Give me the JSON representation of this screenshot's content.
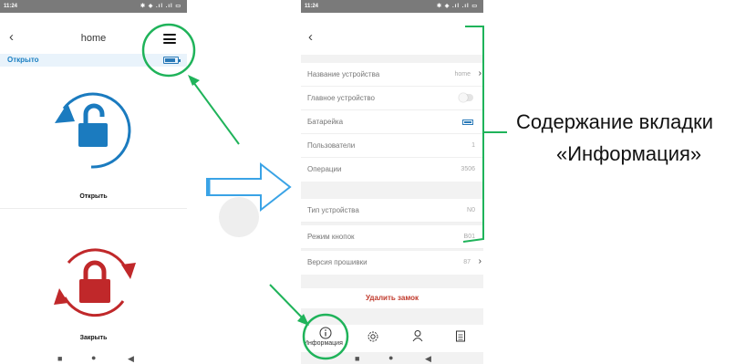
{
  "left_screen": {
    "status_time": "11:24",
    "status_icons": "✱ ◈ .ıl .ıl ▭",
    "header_title": "home",
    "status_text": "Открыто",
    "open_label": "Открыть",
    "close_label": "Закрыть"
  },
  "right_screen": {
    "status_time": "11:24",
    "status_icons": "✱ ◈ .ıl .ıl ▭",
    "rows": [
      {
        "label": "Название устройства",
        "value": "home"
      },
      {
        "label": "Главное устройство",
        "value": ""
      },
      {
        "label": "Батарейка",
        "value": ""
      },
      {
        "label": "Пользователи",
        "value": "1"
      },
      {
        "label": "Операции",
        "value": "3506"
      },
      {
        "label": "Тип устройства",
        "value": "N0"
      },
      {
        "label": "Режим кнопок",
        "value": "B01"
      },
      {
        "label": "Версия прошивки",
        "value": "87"
      }
    ],
    "delete_label": "Удалить замок",
    "tab_info_label": "Информация"
  },
  "caption": {
    "line1": "Содержание вкладки",
    "line2": "«Информация»"
  },
  "colors": {
    "open_blue": "#1b7bbf",
    "close_red": "#c0282a",
    "annotation_green": "#1fb35a",
    "arrow_blue": "#3aa3e6"
  },
  "icons": [
    "back-chevron-icon",
    "hamburger-menu-icon",
    "battery-icon",
    "unlock-icon",
    "lock-icon",
    "info-icon",
    "gear-icon",
    "user-icon",
    "clipboard-icon",
    "chevron-right-icon"
  ]
}
